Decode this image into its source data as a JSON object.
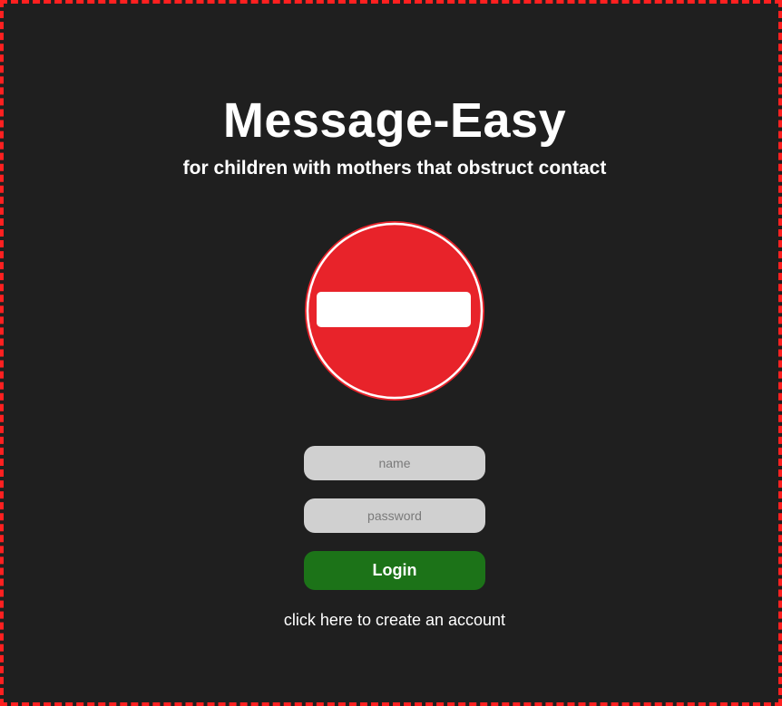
{
  "app": {
    "title": "Message-Easy",
    "subtitle": "for children with mothers that obstruct contact"
  },
  "logo": {
    "icon": "no-entry-sign-icon",
    "circle_color": "#e8232a",
    "bar_color": "#ffffff"
  },
  "form": {
    "name_placeholder": "name",
    "name_value": "",
    "password_placeholder": "password",
    "password_value": "",
    "login_label": "Login",
    "login_color": "#1c7318"
  },
  "footer": {
    "create_account_label": "click here to create an account"
  },
  "colors": {
    "background": "#1f1f1f",
    "border": "#ff2020",
    "field_background": "#d0d0d0"
  }
}
